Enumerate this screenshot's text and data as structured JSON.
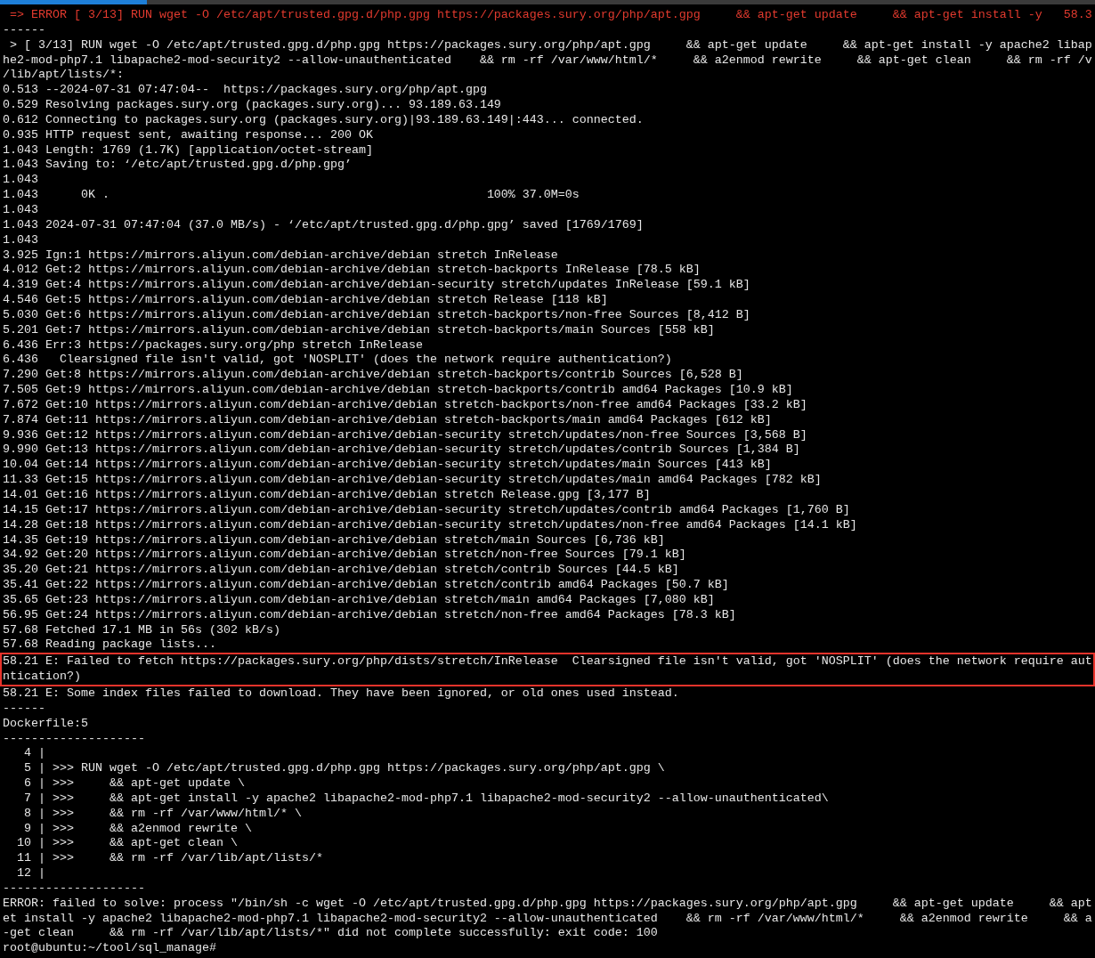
{
  "terminal": {
    "lines": [
      {
        "kind": "error",
        "text": " => ERROR [ 3/13] RUN wget -O /etc/apt/trusted.gpg.d/php.gpg https://packages.sury.org/php/apt.gpg     && apt-get update     && apt-get install -y   58.3"
      },
      {
        "kind": "output",
        "text": "------"
      },
      {
        "kind": "output",
        "text": " > [ 3/13] RUN wget -O /etc/apt/trusted.gpg.d/php.gpg https://packages.sury.org/php/apt.gpg     && apt-get update     && apt-get install -y apache2 libap"
      },
      {
        "kind": "output",
        "text": "he2-mod-php7.1 libapache2-mod-security2 --allow-unauthenticated    && rm -rf /var/www/html/*     && a2enmod rewrite     && apt-get clean     && rm -rf /v"
      },
      {
        "kind": "output",
        "text": "/lib/apt/lists/*:"
      },
      {
        "kind": "output",
        "text": "0.513 --2024-07-31 07:47:04--  https://packages.sury.org/php/apt.gpg"
      },
      {
        "kind": "output",
        "text": "0.529 Resolving packages.sury.org (packages.sury.org)... 93.189.63.149"
      },
      {
        "kind": "output",
        "text": "0.612 Connecting to packages.sury.org (packages.sury.org)|93.189.63.149|:443... connected."
      },
      {
        "kind": "output",
        "text": "0.935 HTTP request sent, awaiting response... 200 OK"
      },
      {
        "kind": "output",
        "text": "1.043 Length: 1769 (1.7K) [application/octet-stream]"
      },
      {
        "kind": "output",
        "text": "1.043 Saving to: ‘/etc/apt/trusted.gpg.d/php.gpg’"
      },
      {
        "kind": "output",
        "text": "1.043"
      },
      {
        "kind": "output",
        "text": "1.043      0K .                                                     100% 37.0M=0s"
      },
      {
        "kind": "output",
        "text": "1.043"
      },
      {
        "kind": "output",
        "text": "1.043 2024-07-31 07:47:04 (37.0 MB/s) - ‘/etc/apt/trusted.gpg.d/php.gpg’ saved [1769/1769]"
      },
      {
        "kind": "output",
        "text": "1.043"
      },
      {
        "kind": "output",
        "text": "3.925 Ign:1 https://mirrors.aliyun.com/debian-archive/debian stretch InRelease"
      },
      {
        "kind": "output",
        "text": "4.012 Get:2 https://mirrors.aliyun.com/debian-archive/debian stretch-backports InRelease [78.5 kB]"
      },
      {
        "kind": "output",
        "text": "4.319 Get:4 https://mirrors.aliyun.com/debian-archive/debian-security stretch/updates InRelease [59.1 kB]"
      },
      {
        "kind": "output",
        "text": "4.546 Get:5 https://mirrors.aliyun.com/debian-archive/debian stretch Release [118 kB]"
      },
      {
        "kind": "output",
        "text": "5.030 Get:6 https://mirrors.aliyun.com/debian-archive/debian stretch-backports/non-free Sources [8,412 B]"
      },
      {
        "kind": "output",
        "text": "5.201 Get:7 https://mirrors.aliyun.com/debian-archive/debian stretch-backports/main Sources [558 kB]"
      },
      {
        "kind": "output",
        "text": "6.436 Err:3 https://packages.sury.org/php stretch InRelease"
      },
      {
        "kind": "output",
        "text": "6.436   Clearsigned file isn't valid, got 'NOSPLIT' (does the network require authentication?)"
      },
      {
        "kind": "output",
        "text": "7.290 Get:8 https://mirrors.aliyun.com/debian-archive/debian stretch-backports/contrib Sources [6,528 B]"
      },
      {
        "kind": "output",
        "text": "7.505 Get:9 https://mirrors.aliyun.com/debian-archive/debian stretch-backports/contrib amd64 Packages [10.9 kB]"
      },
      {
        "kind": "output",
        "text": "7.672 Get:10 https://mirrors.aliyun.com/debian-archive/debian stretch-backports/non-free amd64 Packages [33.2 kB]"
      },
      {
        "kind": "output",
        "text": "7.874 Get:11 https://mirrors.aliyun.com/debian-archive/debian stretch-backports/main amd64 Packages [612 kB]"
      },
      {
        "kind": "output",
        "text": "9.936 Get:12 https://mirrors.aliyun.com/debian-archive/debian-security stretch/updates/non-free Sources [3,568 B]"
      },
      {
        "kind": "output",
        "text": "9.990 Get:13 https://mirrors.aliyun.com/debian-archive/debian-security stretch/updates/contrib Sources [1,384 B]"
      },
      {
        "kind": "output",
        "text": "10.04 Get:14 https://mirrors.aliyun.com/debian-archive/debian-security stretch/updates/main Sources [413 kB]"
      },
      {
        "kind": "output",
        "text": "11.33 Get:15 https://mirrors.aliyun.com/debian-archive/debian-security stretch/updates/main amd64 Packages [782 kB]"
      },
      {
        "kind": "output",
        "text": "14.01 Get:16 https://mirrors.aliyun.com/debian-archive/debian stretch Release.gpg [3,177 B]"
      },
      {
        "kind": "output",
        "text": "14.15 Get:17 https://mirrors.aliyun.com/debian-archive/debian-security stretch/updates/contrib amd64 Packages [1,760 B]"
      },
      {
        "kind": "output",
        "text": "14.28 Get:18 https://mirrors.aliyun.com/debian-archive/debian-security stretch/updates/non-free amd64 Packages [14.1 kB]"
      },
      {
        "kind": "output",
        "text": "14.35 Get:19 https://mirrors.aliyun.com/debian-archive/debian stretch/main Sources [6,736 kB]"
      },
      {
        "kind": "output",
        "text": "34.92 Get:20 https://mirrors.aliyun.com/debian-archive/debian stretch/non-free Sources [79.1 kB]"
      },
      {
        "kind": "output",
        "text": "35.20 Get:21 https://mirrors.aliyun.com/debian-archive/debian stretch/contrib Sources [44.5 kB]"
      },
      {
        "kind": "output",
        "text": "35.41 Get:22 https://mirrors.aliyun.com/debian-archive/debian stretch/contrib amd64 Packages [50.7 kB]"
      },
      {
        "kind": "output",
        "text": "35.65 Get:23 https://mirrors.aliyun.com/debian-archive/debian stretch/main amd64 Packages [7,080 kB]"
      },
      {
        "kind": "output",
        "text": "56.95 Get:24 https://mirrors.aliyun.com/debian-archive/debian stretch/non-free amd64 Packages [78.3 kB]"
      },
      {
        "kind": "output",
        "text": "57.68 Fetched 17.1 MB in 56s (302 kB/s)"
      },
      {
        "kind": "output",
        "text": "57.68 Reading package lists..."
      },
      {
        "kind": "highlighted",
        "text": "58.21 E: Failed to fetch https://packages.sury.org/php/dists/stretch/InRelease  Clearsigned file isn't valid, got 'NOSPLIT' (does the network require aut"
      },
      {
        "kind": "highlighted",
        "text": "ntication?)"
      },
      {
        "kind": "output",
        "text": "58.21 E: Some index files failed to download. They have been ignored, or old ones used instead."
      },
      {
        "kind": "output",
        "text": "------"
      },
      {
        "kind": "output",
        "text": "Dockerfile:5"
      },
      {
        "kind": "output",
        "text": "--------------------"
      },
      {
        "kind": "output",
        "text": "   4 |"
      },
      {
        "kind": "output",
        "text": "   5 | >>> RUN wget -O /etc/apt/trusted.gpg.d/php.gpg https://packages.sury.org/php/apt.gpg \\"
      },
      {
        "kind": "output",
        "text": "   6 | >>>     && apt-get update \\"
      },
      {
        "kind": "output",
        "text": "   7 | >>>     && apt-get install -y apache2 libapache2-mod-php7.1 libapache2-mod-security2 --allow-unauthenticated\\"
      },
      {
        "kind": "output",
        "text": "   8 | >>>     && rm -rf /var/www/html/* \\"
      },
      {
        "kind": "output",
        "text": "   9 | >>>     && a2enmod rewrite \\"
      },
      {
        "kind": "output",
        "text": "  10 | >>>     && apt-get clean \\"
      },
      {
        "kind": "output",
        "text": "  11 | >>>     && rm -rf /var/lib/apt/lists/*"
      },
      {
        "kind": "output",
        "text": "  12 |"
      },
      {
        "kind": "output",
        "text": "--------------------"
      },
      {
        "kind": "output",
        "text": "ERROR: failed to solve: process \"/bin/sh -c wget -O /etc/apt/trusted.gpg.d/php.gpg https://packages.sury.org/php/apt.gpg     && apt-get update     && apt"
      },
      {
        "kind": "output",
        "text": "et install -y apache2 libapache2-mod-php7.1 libapache2-mod-security2 --allow-unauthenticated    && rm -rf /var/www/html/*     && a2enmod rewrite     && a"
      },
      {
        "kind": "output",
        "text": "-get clean     && rm -rf /var/lib/apt/lists/*\" did not complete successfully: exit code: 100"
      },
      {
        "kind": "output",
        "text": "root@ubuntu:~/tool/sql_manage#"
      }
    ]
  }
}
